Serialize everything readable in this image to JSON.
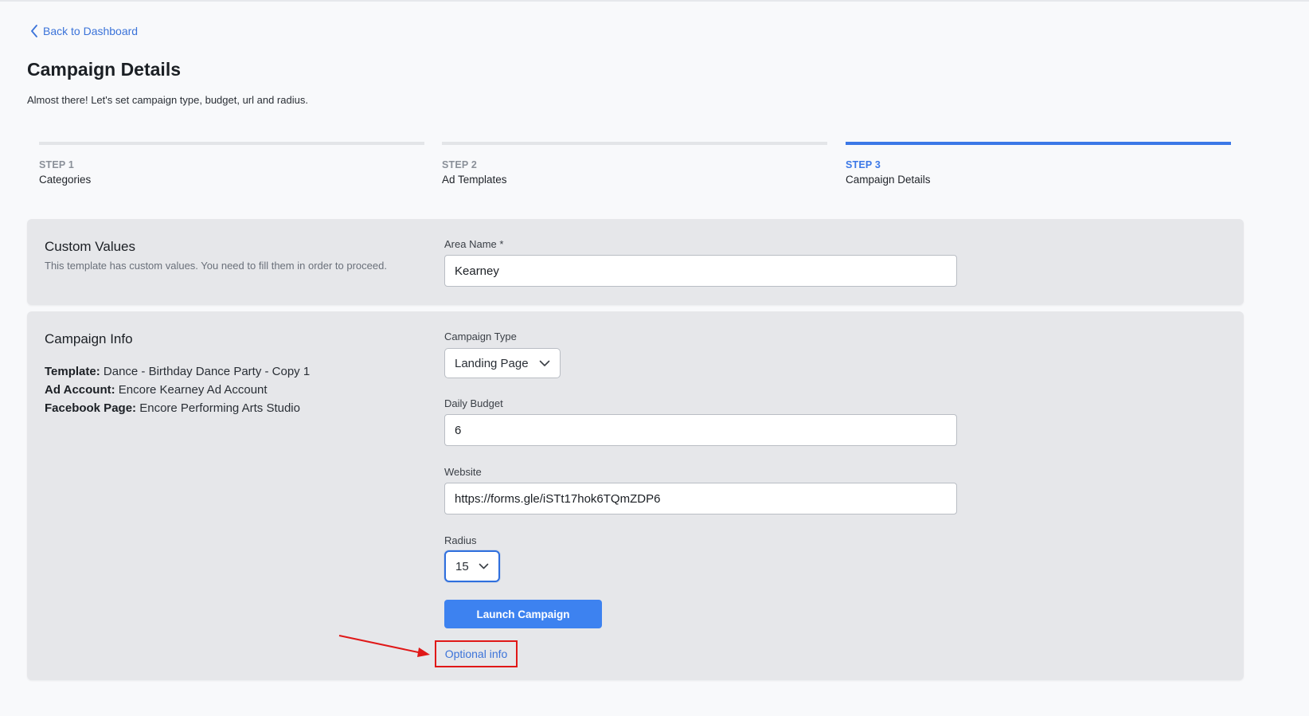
{
  "nav": {
    "back_label": "Back to Dashboard"
  },
  "header": {
    "title": "Campaign Details",
    "subtitle": "Almost there! Let's set campaign type, budget, url and radius."
  },
  "steps": [
    {
      "number": "STEP 1",
      "name": "Categories",
      "active": false
    },
    {
      "number": "STEP 2",
      "name": "Ad Templates",
      "active": false
    },
    {
      "number": "STEP 3",
      "name": "Campaign Details",
      "active": true
    }
  ],
  "custom_values": {
    "title": "Custom Values",
    "description": "This template has custom values. You need to fill them in order to proceed.",
    "area_name_label": "Area Name *",
    "area_name_value": "Kearney"
  },
  "campaign_info": {
    "title": "Campaign Info",
    "template_label": "Template:",
    "template_value": "Dance - Birthday Dance Party - Copy 1",
    "ad_account_label": "Ad Account:",
    "ad_account_value": "Encore Kearney Ad Account",
    "facebook_page_label": "Facebook Page:",
    "facebook_page_value": "Encore Performing Arts Studio",
    "campaign_type_label": "Campaign Type",
    "campaign_type_value": "Landing Page",
    "daily_budget_label": "Daily Budget",
    "daily_budget_value": "6",
    "website_label": "Website",
    "website_value": "https://forms.gle/iSTt17hok6TQmZDP6",
    "radius_label": "Radius",
    "radius_value": "15",
    "launch_label": "Launch Campaign",
    "optional_label": "Optional info"
  },
  "colors": {
    "accent": "#3b78e7",
    "button": "#3d82f0",
    "link": "#3b73d9",
    "annotation": "#e01818",
    "card_bg": "#e6e7ea"
  },
  "icons": {
    "back": "chevron-left-icon",
    "dropdown": "chevron-down-icon",
    "annotation": "red-arrow-icon"
  }
}
